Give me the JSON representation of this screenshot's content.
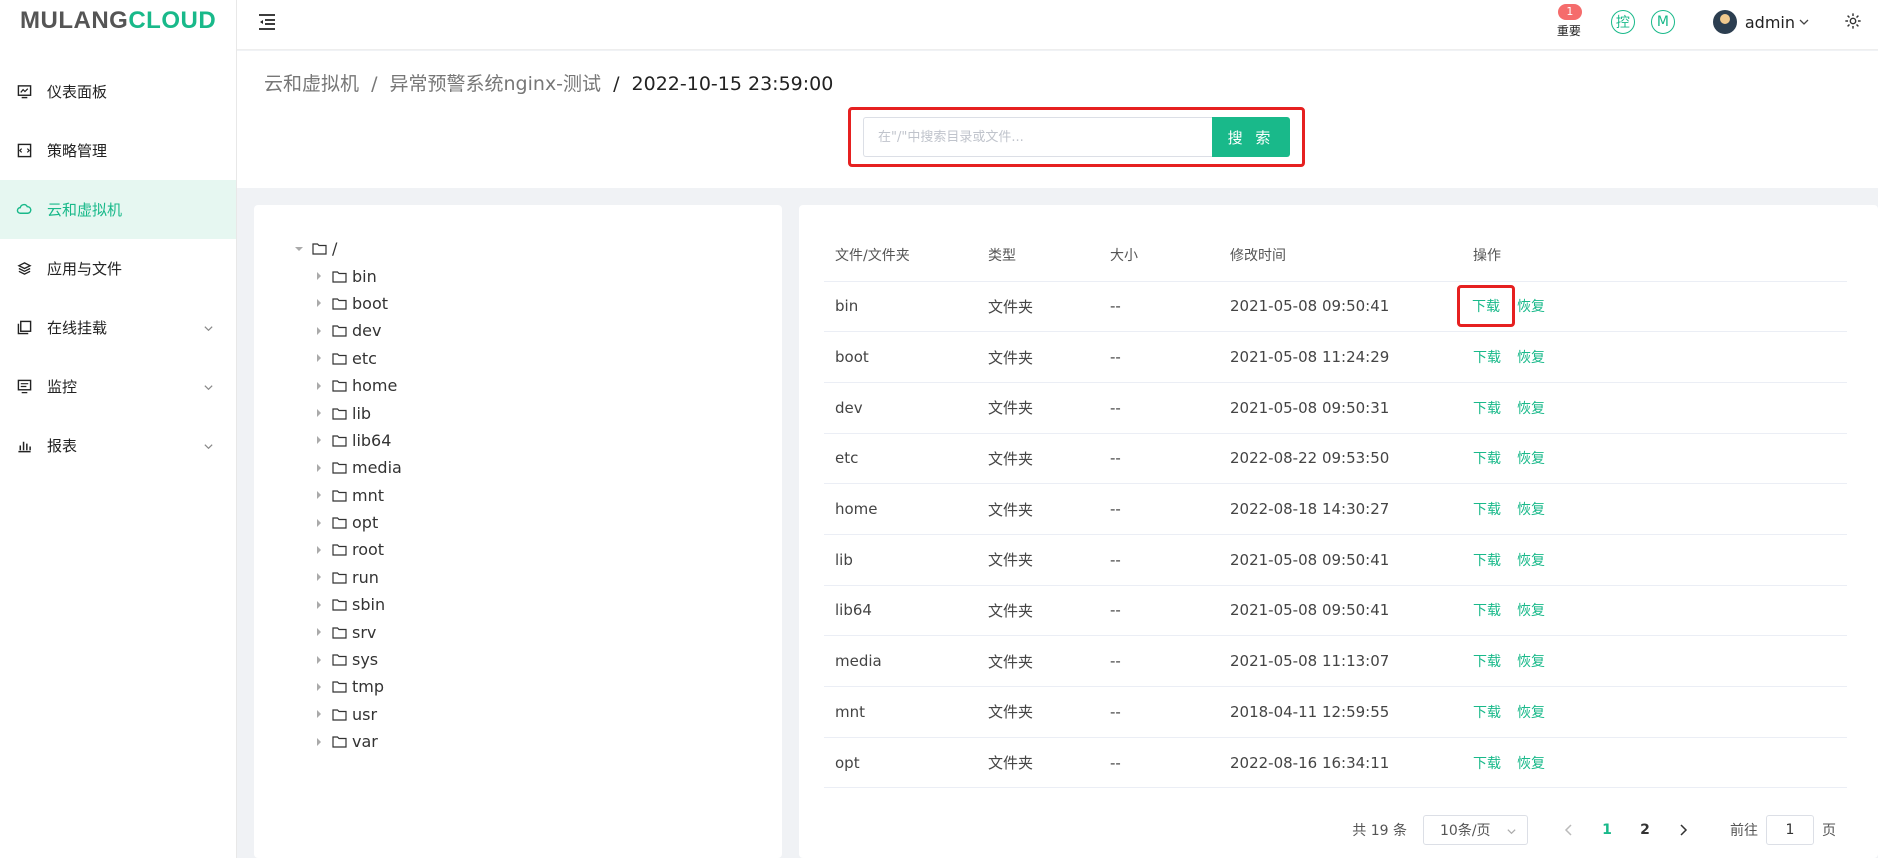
{
  "logo": {
    "part1": "MULANG",
    "part2": "CLOUD"
  },
  "sidebar": {
    "items": [
      {
        "label": "仪表面板",
        "icon": "dashboard-icon",
        "active": false,
        "expandable": false
      },
      {
        "label": "策略管理",
        "icon": "policy-icon",
        "active": false,
        "expandable": false
      },
      {
        "label": "云和虚拟机",
        "icon": "cloud-icon",
        "active": true,
        "expandable": false
      },
      {
        "label": "应用与文件",
        "icon": "layers-icon",
        "active": false,
        "expandable": false
      },
      {
        "label": "在线挂载",
        "icon": "mount-icon",
        "active": false,
        "expandable": true
      },
      {
        "label": "监控",
        "icon": "monitor-icon",
        "active": false,
        "expandable": true
      },
      {
        "label": "报表",
        "icon": "report-icon",
        "active": false,
        "expandable": true
      }
    ]
  },
  "header": {
    "notice_count": "1",
    "notice_label": "重要",
    "circle1": "控",
    "circle2": "M",
    "user_name": "admin"
  },
  "breadcrumb": {
    "level1": "云和虚拟机",
    "sep1": "/",
    "level2": "异常预警系统nginx-测试",
    "sep2": "/",
    "current": "2022-10-15 23:59:00"
  },
  "search": {
    "placeholder": "在\"/\"中搜索目录或文件...",
    "button": "搜 索"
  },
  "tree": {
    "root": "/",
    "children": [
      "bin",
      "boot",
      "dev",
      "etc",
      "home",
      "lib",
      "lib64",
      "media",
      "mnt",
      "opt",
      "root",
      "run",
      "sbin",
      "srv",
      "sys",
      "tmp",
      "usr",
      "var"
    ]
  },
  "table": {
    "headers": [
      "文件/文件夹",
      "类型",
      "大小",
      "修改时间",
      "操作"
    ],
    "action_download": "下载",
    "action_restore": "恢复",
    "rows": [
      {
        "name": "bin",
        "type": "文件夹",
        "size": "--",
        "mtime": "2021-05-08 09:50:41"
      },
      {
        "name": "boot",
        "type": "文件夹",
        "size": "--",
        "mtime": "2021-05-08 11:24:29"
      },
      {
        "name": "dev",
        "type": "文件夹",
        "size": "--",
        "mtime": "2021-05-08 09:50:31"
      },
      {
        "name": "etc",
        "type": "文件夹",
        "size": "--",
        "mtime": "2022-08-22 09:53:50"
      },
      {
        "name": "home",
        "type": "文件夹",
        "size": "--",
        "mtime": "2022-08-18 14:30:27"
      },
      {
        "name": "lib",
        "type": "文件夹",
        "size": "--",
        "mtime": "2021-05-08 09:50:41"
      },
      {
        "name": "lib64",
        "type": "文件夹",
        "size": "--",
        "mtime": "2021-05-08 09:50:41"
      },
      {
        "name": "media",
        "type": "文件夹",
        "size": "--",
        "mtime": "2021-05-08 11:13:07"
      },
      {
        "name": "mnt",
        "type": "文件夹",
        "size": "--",
        "mtime": "2018-04-11 12:59:55"
      },
      {
        "name": "opt",
        "type": "文件夹",
        "size": "--",
        "mtime": "2022-08-16 16:34:11"
      }
    ]
  },
  "pagination": {
    "total": "共 19 条",
    "page_size": "10条/页",
    "pages": [
      "1",
      "2"
    ],
    "current_page": "1",
    "goto_prefix": "前往",
    "goto_value": "1",
    "goto_suffix": "页"
  },
  "colors": {
    "accent": "#19b98a",
    "highlight": "#e62020",
    "active_bg": "#e6f7f1"
  }
}
